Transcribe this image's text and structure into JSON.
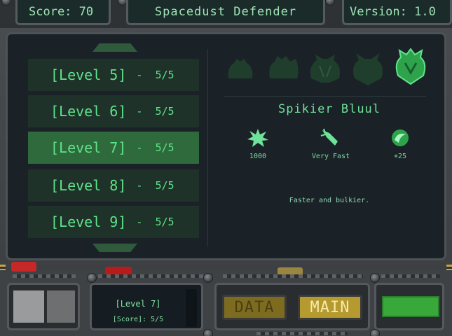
{
  "header": {
    "score": "Score: 70",
    "title": "Spacedust Defender",
    "version": "Version: 1.0"
  },
  "levels": [
    {
      "label": "[Level 5]",
      "progress": "5/5",
      "selected": false
    },
    {
      "label": "[Level 6]",
      "progress": "5/5",
      "selected": false
    },
    {
      "label": "[Level 7]",
      "progress": "5/5",
      "selected": true
    },
    {
      "label": "[Level 8]",
      "progress": "5/5",
      "selected": false
    },
    {
      "label": "[Level 9]",
      "progress": "5/5",
      "selected": false
    }
  ],
  "enemy": {
    "name": "Spikier Bluul",
    "description": "Faster and bulkier.",
    "stats": [
      {
        "icon": "explosion-icon",
        "value": "1000"
      },
      {
        "icon": "speed-rocket-icon",
        "value": "Very Fast"
      },
      {
        "icon": "swirl-reward-icon",
        "value": "+25"
      }
    ]
  },
  "panel": {
    "info_level": "[Level 7]",
    "info_score": "[Score]: 5/5",
    "data_button": "DATA",
    "main_button": "MAIN"
  },
  "colors": {
    "accent_green": "#5fe38a",
    "selected_row": "#2e6a3c",
    "main_button": "#b59a2f"
  }
}
